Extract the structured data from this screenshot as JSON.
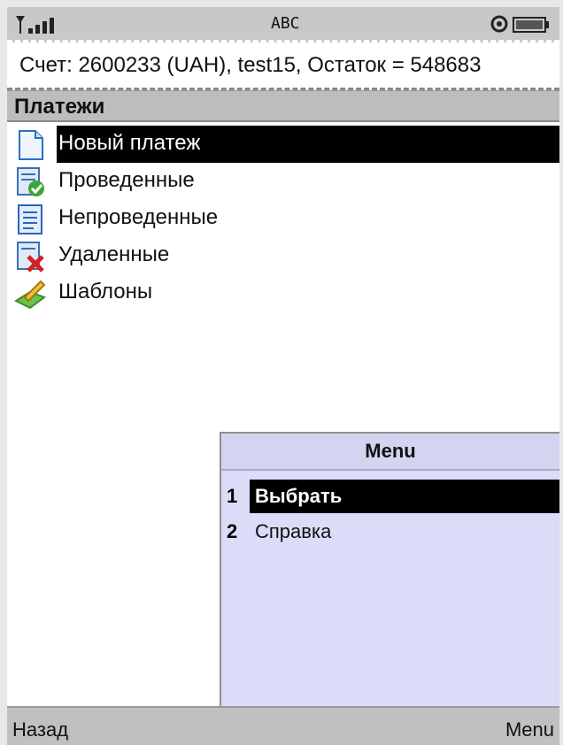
{
  "status_bar": {
    "signal_icon": "signal-strength-icon",
    "input_mode": "ABC",
    "settings_icon": "gear-icon",
    "battery_icon": "battery-icon"
  },
  "account": {
    "text": "Счет: 2600233 (UAH), test15, Остаток = 548683"
  },
  "screen": {
    "title": "Платежи"
  },
  "list": {
    "items": [
      {
        "label": "Новый платеж",
        "icon": "new-document-icon",
        "selected": true
      },
      {
        "label": "Проведенные",
        "icon": "completed-document-icon",
        "selected": false
      },
      {
        "label": "Непроведенные",
        "icon": "pending-document-icon",
        "selected": false
      },
      {
        "label": "Удаленные",
        "icon": "deleted-document-icon",
        "selected": false
      },
      {
        "label": "Шаблоны",
        "icon": "templates-icon",
        "selected": false
      }
    ]
  },
  "menu": {
    "title": "Menu",
    "items": [
      {
        "number": "1",
        "label": "Выбрать",
        "selected": true
      },
      {
        "number": "2",
        "label": "Справка",
        "selected": false
      }
    ]
  },
  "softkeys": {
    "left": "Назад",
    "right": "Menu"
  },
  "colors": {
    "selection": "#000000",
    "menu_background": "#dcdcf8",
    "title_bar": "#bdbdbd"
  }
}
